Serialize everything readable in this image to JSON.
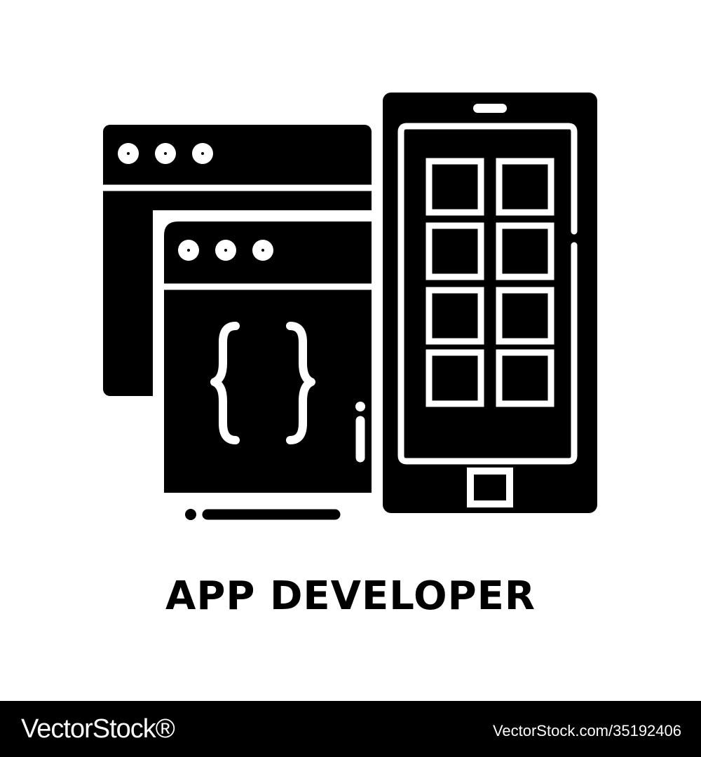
{
  "icon": {
    "name": "app-developer-icon",
    "color": "#000000",
    "background": "#ffffff",
    "parts": [
      "browser-window-icon",
      "code-window-icon",
      "curly-braces-icon",
      "smartphone-icon",
      "app-grid-icon"
    ]
  },
  "caption": "APP DEVELOPER",
  "footer": {
    "brand": "VectorStock®",
    "image_id": "VectorStock.com/35192406",
    "background": "#000000",
    "text_color": "#ffffff"
  }
}
